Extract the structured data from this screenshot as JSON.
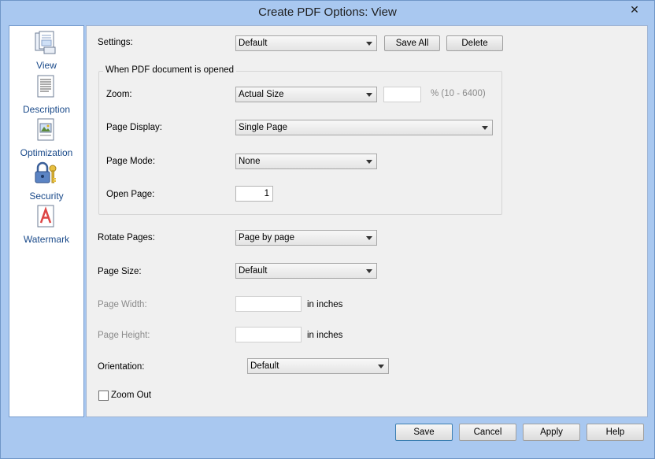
{
  "window": {
    "title": "Create PDF Options: View",
    "close_glyph": "✕"
  },
  "sidebar": {
    "items": [
      {
        "label": "View",
        "icon": "view-page-icon"
      },
      {
        "label": "Description",
        "icon": "description-document-icon"
      },
      {
        "label": "Optimization",
        "icon": "optimization-image-icon"
      },
      {
        "label": "Security",
        "icon": "security-lock-key-icon"
      },
      {
        "label": "Watermark",
        "icon": "watermark-letter-icon"
      }
    ]
  },
  "settings": {
    "label": "Settings:",
    "value": "Default",
    "save_all": "Save All",
    "delete": "Delete"
  },
  "open_group": {
    "title": "When PDF document is opened",
    "zoom_label": "Zoom:",
    "zoom_value": "Actual Size",
    "zoom_percent": "",
    "zoom_range": "% (10 - 6400)",
    "page_display_label": "Page Display:",
    "page_display_value": "Single Page",
    "page_mode_label": "Page Mode:",
    "page_mode_value": "None",
    "open_page_label": "Open Page:",
    "open_page_value": "1"
  },
  "rotate": {
    "label": "Rotate Pages:",
    "value": "Page by page"
  },
  "page_size": {
    "label": "Page Size:",
    "value": "Default"
  },
  "page_width": {
    "label": "Page Width:",
    "unit": "in inches",
    "value": ""
  },
  "page_height": {
    "label": "Page Height:",
    "unit": "in inches",
    "value": ""
  },
  "orientation": {
    "label": "Orientation:",
    "value": "Default"
  },
  "zoom_out": {
    "label": "Zoom Out",
    "checked": false
  },
  "footer": {
    "save": "Save",
    "cancel": "Cancel",
    "apply": "Apply",
    "help": "Help"
  }
}
